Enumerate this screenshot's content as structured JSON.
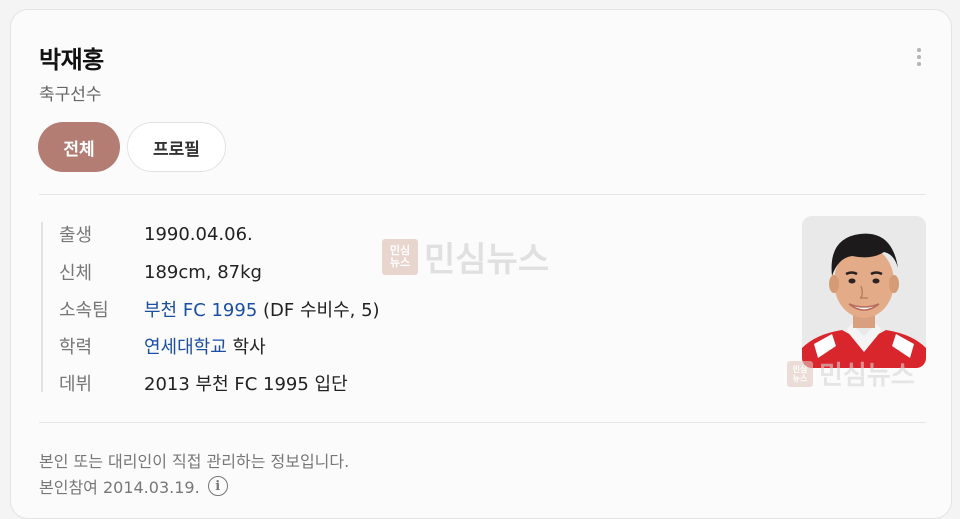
{
  "header": {
    "name": "박재홍",
    "occupation": "축구선수"
  },
  "tabs": [
    {
      "label": "전체",
      "active": true
    },
    {
      "label": "프로필",
      "active": false
    }
  ],
  "profile": {
    "birth": {
      "label": "출생",
      "value": "1990.04.06."
    },
    "body": {
      "label": "신체",
      "value": "189cm, 87kg"
    },
    "team": {
      "label": "소속팀",
      "link": "부천 FC 1995",
      "extra": " (DF 수비수, 5)"
    },
    "education": {
      "label": "학력",
      "link": "연세대학교",
      "extra": " 학사"
    },
    "debut": {
      "label": "데뷔",
      "value": "2013 부천 FC 1995 입단"
    }
  },
  "watermark": {
    "text": "민심뉴스",
    "logo": "민심뉴스"
  },
  "footer": {
    "notice": "본인 또는 대리인이 직접 관리하는 정보입니다.",
    "registration": "본인참여 2014.03.19.",
    "info_icon": "i"
  },
  "icons": {
    "more": "more-vertical-icon",
    "info": "info-icon"
  },
  "colors": {
    "active_tab": "#b37d73",
    "link": "#1a4fa3"
  }
}
